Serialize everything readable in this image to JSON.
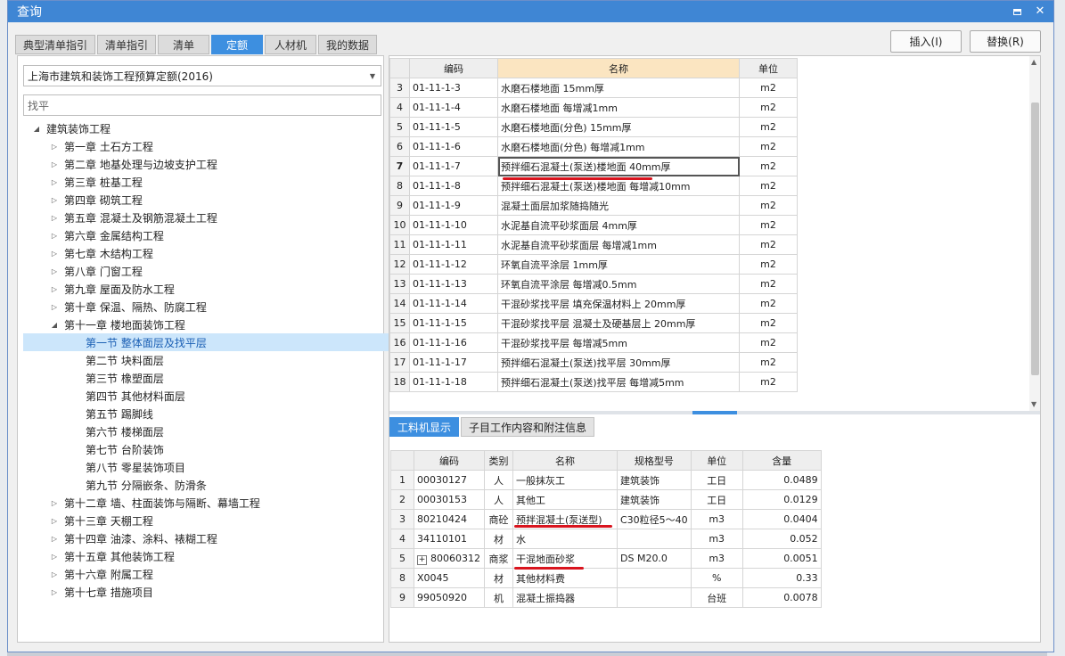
{
  "window": {
    "title": "查询"
  },
  "tabs": [
    "典型清单指引",
    "清单指引",
    "清单",
    "定额",
    "人材机",
    "我的数据"
  ],
  "active_tab": 3,
  "buttons": {
    "insert": "插入(I)",
    "replace": "替换(R)"
  },
  "left": {
    "library": "上海市建筑和装饰工程预算定额(2016)",
    "search_value": "找平",
    "tree": [
      {
        "label": "建筑装饰工程",
        "level": 0,
        "state": "open"
      },
      {
        "label": "第一章 土石方工程",
        "level": 1,
        "state": "closed"
      },
      {
        "label": "第二章 地基处理与边坡支护工程",
        "level": 1,
        "state": "closed"
      },
      {
        "label": "第三章 桩基工程",
        "level": 1,
        "state": "closed"
      },
      {
        "label": "第四章 砌筑工程",
        "level": 1,
        "state": "closed"
      },
      {
        "label": "第五章 混凝土及钢筋混凝土工程",
        "level": 1,
        "state": "closed"
      },
      {
        "label": "第六章 金属结构工程",
        "level": 1,
        "state": "closed"
      },
      {
        "label": "第七章 木结构工程",
        "level": 1,
        "state": "closed"
      },
      {
        "label": "第八章 门窗工程",
        "level": 1,
        "state": "closed"
      },
      {
        "label": "第九章 屋面及防水工程",
        "level": 1,
        "state": "closed"
      },
      {
        "label": "第十章 保温、隔热、防腐工程",
        "level": 1,
        "state": "closed"
      },
      {
        "label": "第十一章 楼地面装饰工程",
        "level": 1,
        "state": "open"
      },
      {
        "label": "第一节 整体面层及找平层",
        "level": 2,
        "state": "leaf",
        "selected": true
      },
      {
        "label": "第二节 块料面层",
        "level": 2,
        "state": "leaf"
      },
      {
        "label": "第三节 橡塑面层",
        "level": 2,
        "state": "leaf"
      },
      {
        "label": "第四节 其他材料面层",
        "level": 2,
        "state": "leaf"
      },
      {
        "label": "第五节 踢脚线",
        "level": 2,
        "state": "leaf"
      },
      {
        "label": "第六节 楼梯面层",
        "level": 2,
        "state": "leaf"
      },
      {
        "label": "第七节 台阶装饰",
        "level": 2,
        "state": "leaf"
      },
      {
        "label": "第八节 零星装饰项目",
        "level": 2,
        "state": "leaf"
      },
      {
        "label": "第九节 分隔嵌条、防滑条",
        "level": 2,
        "state": "leaf"
      },
      {
        "label": "第十二章 墙、柱面装饰与隔断、幕墙工程",
        "level": 1,
        "state": "closed"
      },
      {
        "label": "第十三章 天棚工程",
        "level": 1,
        "state": "closed"
      },
      {
        "label": "第十四章 油漆、涂料、裱糊工程",
        "level": 1,
        "state": "closed"
      },
      {
        "label": "第十五章 其他装饰工程",
        "level": 1,
        "state": "closed"
      },
      {
        "label": "第十六章 附属工程",
        "level": 1,
        "state": "closed"
      },
      {
        "label": "第十七章 措施项目",
        "level": 1,
        "state": "closed"
      }
    ]
  },
  "upper_table": {
    "headers": [
      "编码",
      "名称",
      "单位"
    ],
    "current_row": "7",
    "rows": [
      {
        "n": "3",
        "code": "01-11-1-3",
        "name": "水磨石楼地面 15mm厚",
        "unit": "m2"
      },
      {
        "n": "4",
        "code": "01-11-1-4",
        "name": "水磨石楼地面 每增减1mm",
        "unit": "m2"
      },
      {
        "n": "5",
        "code": "01-11-1-5",
        "name": "水磨石楼地面(分色) 15mm厚",
        "unit": "m2"
      },
      {
        "n": "6",
        "code": "01-11-1-6",
        "name": "水磨石楼地面(分色) 每增减1mm",
        "unit": "m2"
      },
      {
        "n": "7",
        "code": "01-11-1-7",
        "name": "预拌细石混凝土(泵送)楼地面 40mm厚",
        "unit": "m2"
      },
      {
        "n": "8",
        "code": "01-11-1-8",
        "name": "预拌细石混凝土(泵送)楼地面 每增减10mm",
        "unit": "m2"
      },
      {
        "n": "9",
        "code": "01-11-1-9",
        "name": "混凝土面层加浆随捣随光",
        "unit": "m2"
      },
      {
        "n": "10",
        "code": "01-11-1-10",
        "name": "水泥基自流平砂浆面层 4mm厚",
        "unit": "m2"
      },
      {
        "n": "11",
        "code": "01-11-1-11",
        "name": "水泥基自流平砂浆面层 每增减1mm",
        "unit": "m2"
      },
      {
        "n": "12",
        "code": "01-11-1-12",
        "name": "环氧自流平涂层 1mm厚",
        "unit": "m2"
      },
      {
        "n": "13",
        "code": "01-11-1-13",
        "name": "环氧自流平涂层 每增减0.5mm",
        "unit": "m2"
      },
      {
        "n": "14",
        "code": "01-11-1-14",
        "name": "干混砂浆找平层 填充保温材料上 20mm厚",
        "unit": "m2"
      },
      {
        "n": "15",
        "code": "01-11-1-15",
        "name": "干混砂浆找平层 混凝土及硬基层上 20mm厚",
        "unit": "m2"
      },
      {
        "n": "16",
        "code": "01-11-1-16",
        "name": "干混砂浆找平层 每增减5mm",
        "unit": "m2"
      },
      {
        "n": "17",
        "code": "01-11-1-17",
        "name": "预拌细石混凝土(泵送)找平层 30mm厚",
        "unit": "m2"
      },
      {
        "n": "18",
        "code": "01-11-1-18",
        "name": "预拌细石混凝土(泵送)找平层 每增减5mm",
        "unit": "m2"
      }
    ]
  },
  "bottom_tabs": [
    "工料机显示",
    "子目工作内容和附注信息"
  ],
  "lower_table": {
    "headers": [
      "编码",
      "类别",
      "名称",
      "规格型号",
      "单位",
      "含量"
    ],
    "rows": [
      {
        "n": "1",
        "code": "00030127",
        "type": "人",
        "name": "一般抹灰工",
        "spec": "建筑装饰",
        "unit": "工日",
        "qty": "0.0489"
      },
      {
        "n": "2",
        "code": "00030153",
        "type": "人",
        "name": "其他工",
        "spec": "建筑装饰",
        "unit": "工日",
        "qty": "0.0129"
      },
      {
        "n": "3",
        "code": "80210424",
        "type": "商砼",
        "name": "预拌混凝土(泵送型)",
        "spec": "C30粒径5～40",
        "unit": "m3",
        "qty": "0.0404"
      },
      {
        "n": "4",
        "code": "34110101",
        "type": "材",
        "name": "水",
        "spec": "",
        "unit": "m3",
        "qty": "0.052"
      },
      {
        "n": "5",
        "code": "80060312",
        "type": "商浆",
        "name": "干混地面砂浆",
        "spec": "DS M20.0",
        "unit": "m3",
        "qty": "0.0051",
        "expandable": true
      },
      {
        "n": "8",
        "code": "X0045",
        "type": "材",
        "name": "其他材料费",
        "spec": "",
        "unit": "%",
        "qty": "0.33"
      },
      {
        "n": "9",
        "code": "99050920",
        "type": "机",
        "name": "混凝土振捣器",
        "spec": "",
        "unit": "台班",
        "qty": "0.0078"
      }
    ]
  },
  "colors": {
    "accent": "#3d8fe0",
    "title_bar": "#3f86d4",
    "annotation": "#d9141e",
    "header_highlight": "#fbe5c1",
    "tree_selected": "#cce6fb"
  }
}
